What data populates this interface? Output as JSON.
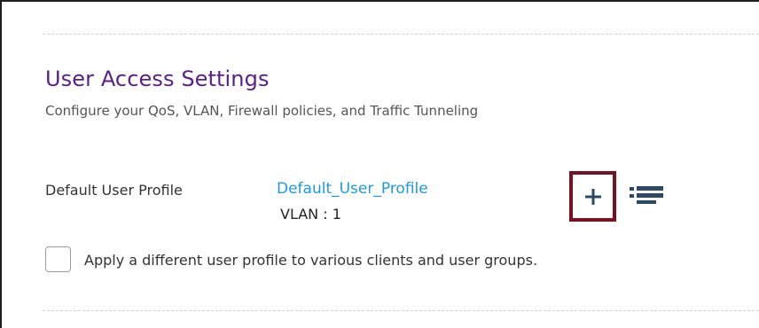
{
  "section": {
    "title": "User Access Settings",
    "subtitle": "Configure your QoS, VLAN, Firewall policies, and Traffic Tunneling"
  },
  "default_profile": {
    "label": "Default User Profile",
    "profile_name": "Default_User_Profile",
    "vlan_label": "VLAN : ",
    "vlan_value": "1"
  },
  "actions": {
    "add_icon": "plus-icon",
    "list_icon": "list-icon"
  },
  "option": {
    "checked": false,
    "label": "Apply a different user profile to various clients and user groups."
  },
  "colors": {
    "title": "#5a1e8c",
    "link": "#1a9be0",
    "highlight_border": "#7a1020",
    "icon": "#2b4a66"
  }
}
